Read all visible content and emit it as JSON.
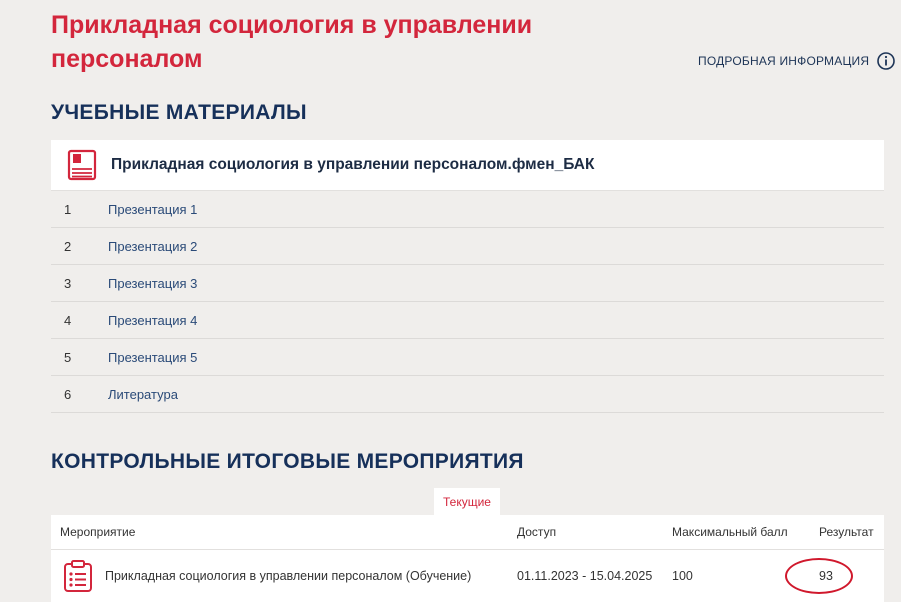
{
  "course": {
    "title": "Прикладная социология в управлении персоналом",
    "info_link": "ПОДРОБНАЯ ИНФОРМАЦИЯ",
    "info_icon": "info-circle-icon"
  },
  "materials": {
    "heading": "УЧЕБНЫЕ МАТЕРИАЛЫ",
    "book_title": "Прикладная социология в управлении персоналом.фмен_БАК",
    "book_icon": "book-icon",
    "items": [
      {
        "num": "1",
        "label": "Презентация 1"
      },
      {
        "num": "2",
        "label": "Презентация 2"
      },
      {
        "num": "3",
        "label": "Презентация 3"
      },
      {
        "num": "4",
        "label": "Презентация 4"
      },
      {
        "num": "5",
        "label": "Презентация 5"
      },
      {
        "num": "6",
        "label": "Литература"
      }
    ]
  },
  "events": {
    "heading": "КОНТРОЛЬНЫЕ ИТОГОВЫЕ МЕРОПРИЯТИЯ",
    "tab_current": "Текущие",
    "columns": [
      "Мероприятие",
      "Доступ",
      "Максимальный балл",
      "Результат"
    ],
    "rows": [
      {
        "icon": "clipboard-icon",
        "name": "Прикладная социология в управлении персоналом (Обучение)",
        "access": "01.11.2023 - 15.04.2025",
        "max_score": "100",
        "result": "93"
      }
    ]
  },
  "colors": {
    "accent_red": "#d3263c",
    "heading_navy": "#16305a",
    "link_blue": "#2a4a78",
    "background": "#f0eeec"
  }
}
